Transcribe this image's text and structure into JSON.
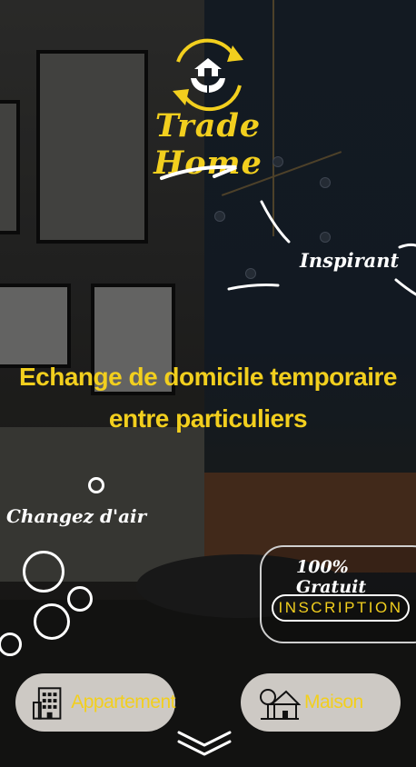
{
  "brand": {
    "name": "Trade Home"
  },
  "labels": {
    "inspirant": "Inspirant",
    "changez": "Changez d'air",
    "gratuit": "100% Gratuit"
  },
  "headline": {
    "line1": "Echange de domicile temporaire",
    "line2": "entre particuliers"
  },
  "cta": {
    "inscription": "INSCRIPTION"
  },
  "choices": [
    {
      "label": "Appartement",
      "icon": "building-icon"
    },
    {
      "label": "Maison",
      "icon": "house-icon"
    }
  ],
  "scroll": {
    "icon": "double-chevron-down-icon"
  },
  "colors": {
    "accent": "#f2cf1e",
    "white": "#ffffff",
    "pill": "#cdc9c4"
  }
}
